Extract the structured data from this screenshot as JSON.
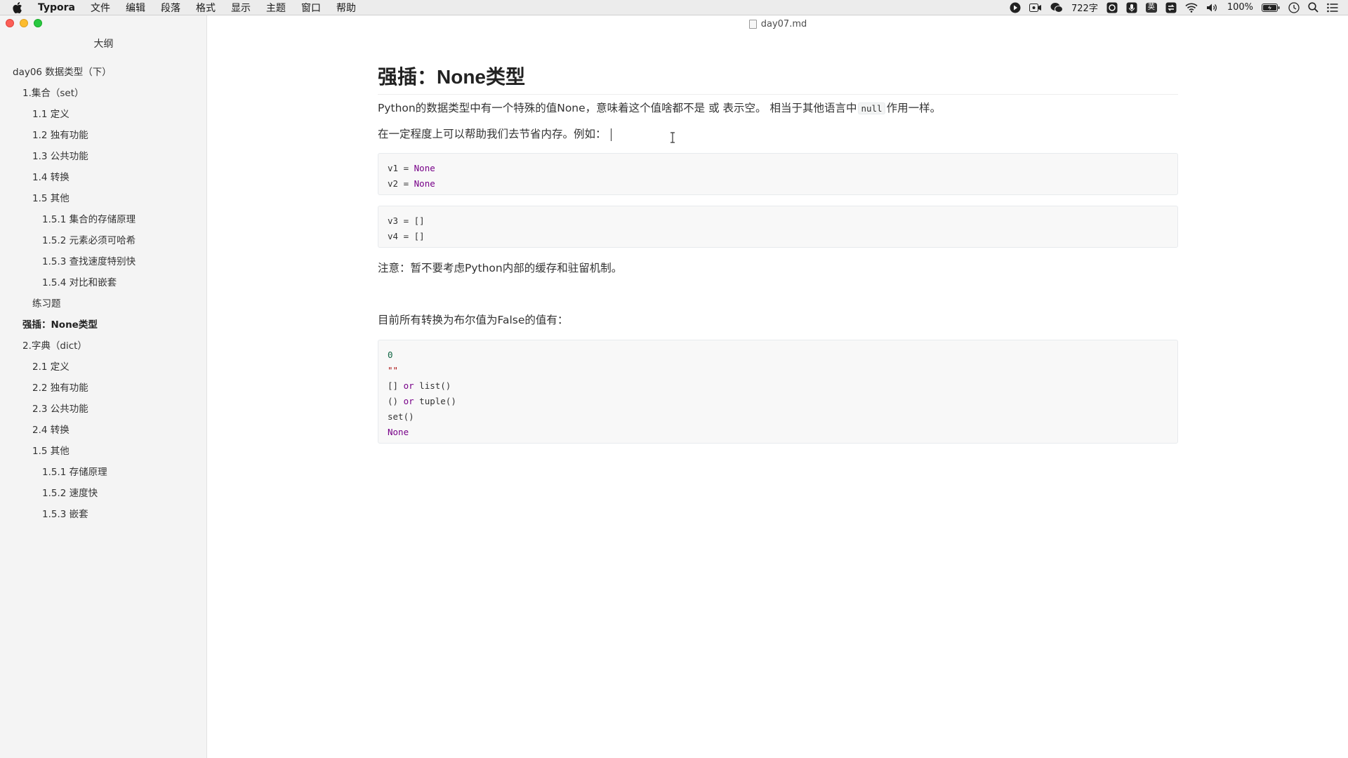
{
  "menubar": {
    "app_name": "Typora",
    "items": [
      "文件",
      "编辑",
      "段落",
      "格式",
      "显示",
      "主题",
      "窗口",
      "帮助"
    ],
    "word_count": "722字",
    "ime_label": "英",
    "battery": "100%"
  },
  "window": {
    "title": "day07.md"
  },
  "sidebar": {
    "title": "大纲",
    "items": [
      {
        "label": "day06 数据类型（下）",
        "level": 1
      },
      {
        "label": "1.集合（set）",
        "level": 2
      },
      {
        "label": "1.1 定义",
        "level": 3
      },
      {
        "label": "1.2 独有功能",
        "level": 3
      },
      {
        "label": "1.3 公共功能",
        "level": 3
      },
      {
        "label": "1.4 转换",
        "level": 3
      },
      {
        "label": "1.5 其他",
        "level": 3
      },
      {
        "label": "1.5.1 集合的存储原理",
        "level": 4
      },
      {
        "label": "1.5.2 元素必须可哈希",
        "level": 4
      },
      {
        "label": "1.5.3 查找速度特别快",
        "level": 4
      },
      {
        "label": "1.5.4 对比和嵌套",
        "level": 4
      },
      {
        "label": "练习题",
        "level": 3
      },
      {
        "label": "强插：None类型",
        "level": 2,
        "active": true
      },
      {
        "label": "2.字典（dict）",
        "level": 2
      },
      {
        "label": "2.1 定义",
        "level": 3
      },
      {
        "label": "2.2 独有功能",
        "level": 3
      },
      {
        "label": "2.3 公共功能",
        "level": 3
      },
      {
        "label": "2.4 转换",
        "level": 3
      },
      {
        "label": "1.5 其他",
        "level": 3
      },
      {
        "label": "1.5.1 存储原理",
        "level": 4
      },
      {
        "label": "1.5.2 速度快",
        "level": 4
      },
      {
        "label": "1.5.3 嵌套",
        "level": 4
      }
    ]
  },
  "doc": {
    "heading": "强插：None类型",
    "p1_before": "Python的数据类型中有一个特殊的值None，意味着这个值啥都不是 或 表示空。 相当于其他语言中",
    "p1_code": "null",
    "p1_after": "作用一样。",
    "p2": "在一定程度上可以帮助我们去节省内存。例如：",
    "code1": {
      "l1_var": "v1 = ",
      "l1_val": "None",
      "l2_var": "v2 = ",
      "l2_val": "None"
    },
    "code2": {
      "l1": "v3 = []",
      "l2": "v4 = []"
    },
    "note": "注意：暂不要考虑Python内部的缓存和驻留机制。",
    "p3": "目前所有转换为布尔值为False的值有：",
    "code3": {
      "l1": "0",
      "l2": "\"\"",
      "l3_a": "[] ",
      "l3_kw": "or",
      "l3_b": " list()",
      "l4_a": "() ",
      "l4_kw": "or",
      "l4_b": " tuple()",
      "l5": "set()",
      "l6": "None"
    }
  },
  "colors": {
    "keyword": "#770088",
    "number": "#116644",
    "string": "#aa1111",
    "code_bg": "#f8f8f8",
    "sidebar_bg": "#f4f4f4"
  }
}
